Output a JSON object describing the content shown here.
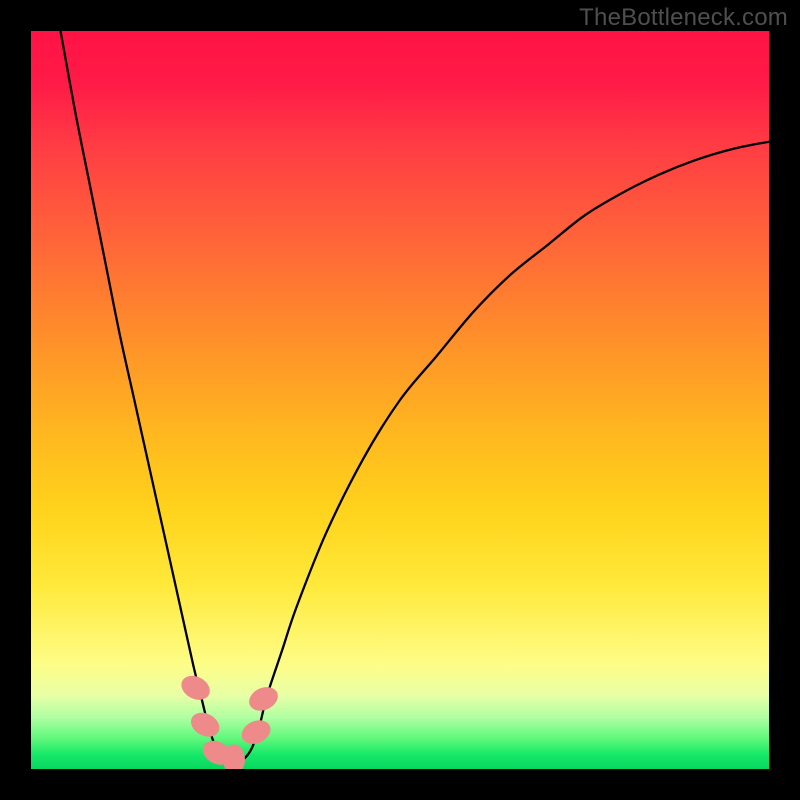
{
  "watermark": "TheBottleneck.com",
  "chart_data": {
    "type": "line",
    "title": "",
    "xlabel": "",
    "ylabel": "",
    "xlim": [
      0,
      100
    ],
    "ylim": [
      0,
      100
    ],
    "grid": false,
    "legend": false,
    "series": [
      {
        "name": "bottleneck-curve",
        "color": "#000000",
        "x": [
          4,
          6,
          8,
          10,
          12,
          14,
          16,
          18,
          20,
          22,
          23,
          24,
          25,
          26,
          27,
          28,
          29,
          30,
          31,
          32,
          34,
          36,
          40,
          45,
          50,
          55,
          60,
          65,
          70,
          75,
          80,
          85,
          90,
          95,
          100
        ],
        "y": [
          100,
          89,
          79,
          69,
          59,
          50,
          41,
          32,
          23,
          14,
          10,
          6,
          3,
          1.5,
          1,
          1,
          1.5,
          3,
          6,
          10,
          16,
          22,
          32,
          42,
          50,
          56,
          62,
          67,
          71,
          75,
          78,
          80.5,
          82.5,
          84,
          85
        ]
      }
    ],
    "markers": [
      {
        "name": "marker-left-upper",
        "x": 22.3,
        "y": 11.0,
        "color": "#ef8a8a"
      },
      {
        "name": "marker-left-mid",
        "x": 23.6,
        "y": 6.0,
        "color": "#ef8a8a"
      },
      {
        "name": "marker-left-low",
        "x": 25.2,
        "y": 2.2,
        "color": "#ef8a8a"
      },
      {
        "name": "marker-bottom",
        "x": 27.5,
        "y": 1.3,
        "color": "#ef8a8a"
      },
      {
        "name": "marker-right-low",
        "x": 30.5,
        "y": 5.0,
        "color": "#ef8a8a"
      },
      {
        "name": "marker-right-upper",
        "x": 31.5,
        "y": 9.5,
        "color": "#ef8a8a"
      }
    ]
  },
  "colors": {
    "curve": "#000000",
    "marker": "#ef8a8a",
    "frame": "#000000"
  }
}
